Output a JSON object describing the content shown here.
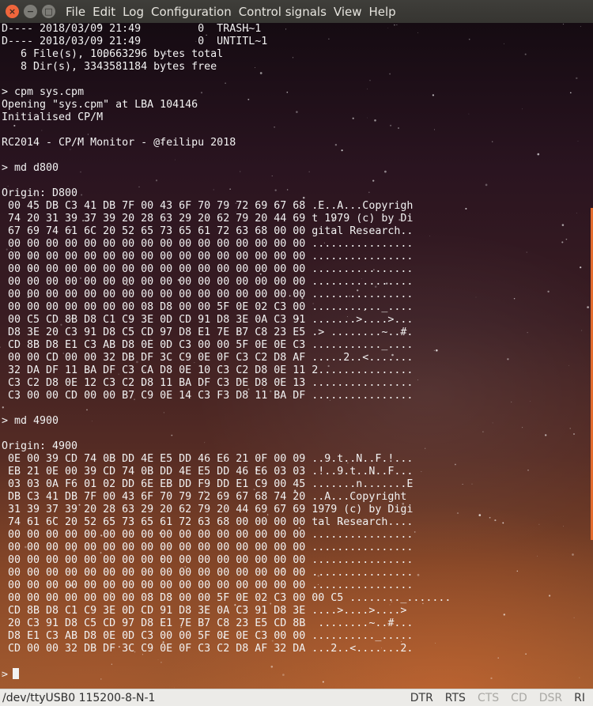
{
  "window": {
    "menu": [
      "File",
      "Edit",
      "Log",
      "Configuration",
      "Control signals",
      "View",
      "Help"
    ]
  },
  "terminal": {
    "lines": [
      "D---- 2018/03/09 21:49         0  TRASH~1",
      "D---- 2018/03/09 21:49         0  UNTITL~1",
      "   6 File(s), 100663296 bytes total",
      "   8 Dir(s), 3343581184 bytes free",
      "",
      "> cpm sys.cpm",
      "Opening \"sys.cpm\" at LBA 104146",
      "Initialised CP/M",
      "",
      "RC2014 - CP/M Monitor - @feilipu 2018",
      "",
      "> md d800",
      "",
      "Origin: D800",
      " 00 45 DB C3 41 DB 7F 00 43 6F 70 79 72 69 67 68 .E..A...Copyrigh",
      " 74 20 31 39 37 39 20 28 63 29 20 62 79 20 44 69 t 1979 (c) by Di",
      " 67 69 74 61 6C 20 52 65 73 65 61 72 63 68 00 00 gital Research..",
      " 00 00 00 00 00 00 00 00 00 00 00 00 00 00 00 00 ................",
      " 00 00 00 00 00 00 00 00 00 00 00 00 00 00 00 00 ................",
      " 00 00 00 00 00 00 00 00 00 00 00 00 00 00 00 00 ................",
      " 00 00 00 00 00 00 00 00 00 00 00 00 00 00 00 00 ................",
      " 00 00 00 00 00 00 00 00 00 00 00 00 00 00 00 00 ................",
      " 00 00 00 00 00 00 00 08 D8 00 00 5F 0E 02 C3 00 ..........._....",
      " 00 C5 CD 8B D8 C1 C9 3E 0D CD 91 D8 3E 0A C3 91 .......>....>...",
      " D8 3E 20 C3 91 D8 C5 CD 97 D8 E1 7E B7 C8 23 E5 .> ........~..#.",
      " CD 8B D8 E1 C3 AB D8 0E 0D C3 00 00 5F 0E 0E C3 ..........._....",
      " 00 00 CD 00 00 32 DB DF 3C C9 0E 0F C3 C2 D8 AF .....2..<.......",
      " 32 DA DF 11 BA DF C3 CA D8 0E 10 C3 C2 D8 0E 11 2...............",
      " C3 C2 D8 0E 12 C3 C2 D8 11 BA DF C3 DE D8 0E 13 ................",
      " C3 00 00 CD 00 00 B7 C9 0E 14 C3 F3 D8 11 BA DF ................",
      "",
      "> md 4900",
      "",
      "Origin: 4900",
      " 0E 00 39 CD 74 0B DD 4E E5 DD 46 E6 21 0F 00 09 ..9.t..N..F.!...",
      " EB 21 0E 00 39 CD 74 0B DD 4E E5 DD 46 E6 03 03 .!..9.t..N..F...",
      " 03 03 0A F6 01 02 DD 6E EB DD F9 DD E1 C9 00 45 .......n.......E",
      " DB C3 41 DB 7F 00 43 6F 70 79 72 69 67 68 74 20 ..A...Copyright ",
      " 31 39 37 39 20 28 63 29 20 62 79 20 44 69 67 69 1979 (c) by Digi",
      " 74 61 6C 20 52 65 73 65 61 72 63 68 00 00 00 00 tal Research....",
      " 00 00 00 00 00 00 00 00 00 00 00 00 00 00 00 00 ................",
      " 00 00 00 00 00 00 00 00 00 00 00 00 00 00 00 00 ................",
      " 00 00 00 00 00 00 00 00 00 00 00 00 00 00 00 00 ................",
      " 00 00 00 00 00 00 00 00 00 00 00 00 00 00 00 00 ................",
      " 00 00 00 00 00 00 00 00 00 00 00 00 00 00 00 00 ................",
      " 00 00 00 00 00 00 00 08 D8 00 00 5F 0E 02 C3 00 00 C5 ........_.......",
      " CD 8B D8 C1 C9 3E 0D CD 91 D8 3E 0A C3 91 D8 3E ....>....>....>",
      " 20 C3 91 D8 C5 CD 97 D8 E1 7E B7 C8 23 E5 CD 8B  ........~..#...",
      " D8 E1 C3 AB D8 0E 0D C3 00 00 5F 0E 0E C3 00 00 .........._.....",
      " CD 00 00 32 DB DF 3C C9 0E 0F C3 C2 D8 AF 32 DA ...2..<.......2.",
      ""
    ],
    "prompt": ">"
  },
  "statusbar": {
    "port": "/dev/ttyUSB0  115200-8-N-1",
    "signals": [
      {
        "label": "DTR",
        "active": true
      },
      {
        "label": "RTS",
        "active": true
      },
      {
        "label": "CTS",
        "active": false
      },
      {
        "label": "CD",
        "active": false
      },
      {
        "label": "DSR",
        "active": false
      },
      {
        "label": "RI",
        "active": true
      }
    ]
  }
}
